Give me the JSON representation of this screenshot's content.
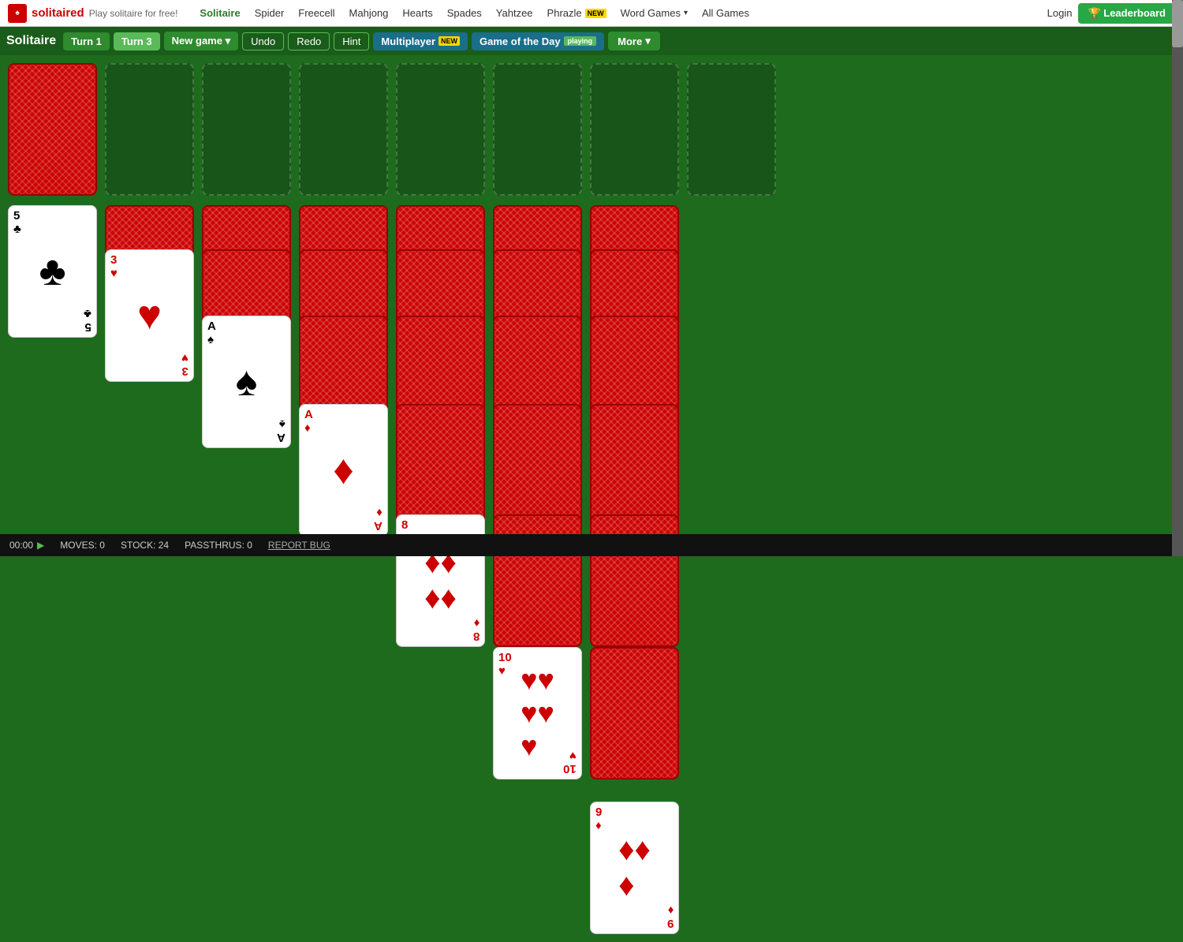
{
  "topnav": {
    "logo_text": "solitaired",
    "logo_tagline": "Play solitaire for free!",
    "links": [
      {
        "label": "Solitaire",
        "active": true
      },
      {
        "label": "Spider"
      },
      {
        "label": "Freecell"
      },
      {
        "label": "Mahjong"
      },
      {
        "label": "Hearts"
      },
      {
        "label": "Spades"
      },
      {
        "label": "Yahtzee"
      },
      {
        "label": "Phrazle",
        "badge": "NEW"
      },
      {
        "label": "Word Games",
        "dropdown": true
      },
      {
        "label": "All Games"
      }
    ],
    "login": "Login",
    "leaderboard": "🏆 Leaderboard"
  },
  "toolbar": {
    "title": "Solitaire",
    "turn1": "Turn 1",
    "turn3": "Turn 3",
    "new_game": "New game",
    "undo": "Undo",
    "redo": "Redo",
    "hint": "Hint",
    "multiplayer": "Multiplayer",
    "multiplayer_badge": "NEW",
    "gotd": "Game of the Day",
    "gotd_badge": "playing",
    "more": "More"
  },
  "statusbar": {
    "timer": "00:00",
    "moves_label": "MOVES: 0",
    "stock_label": "STOCK: 24",
    "passthrus_label": "PASSTHRUS: 0",
    "report": "REPORT BUG"
  },
  "game": {
    "colors": {
      "bg": "#1e6b1e"
    }
  }
}
